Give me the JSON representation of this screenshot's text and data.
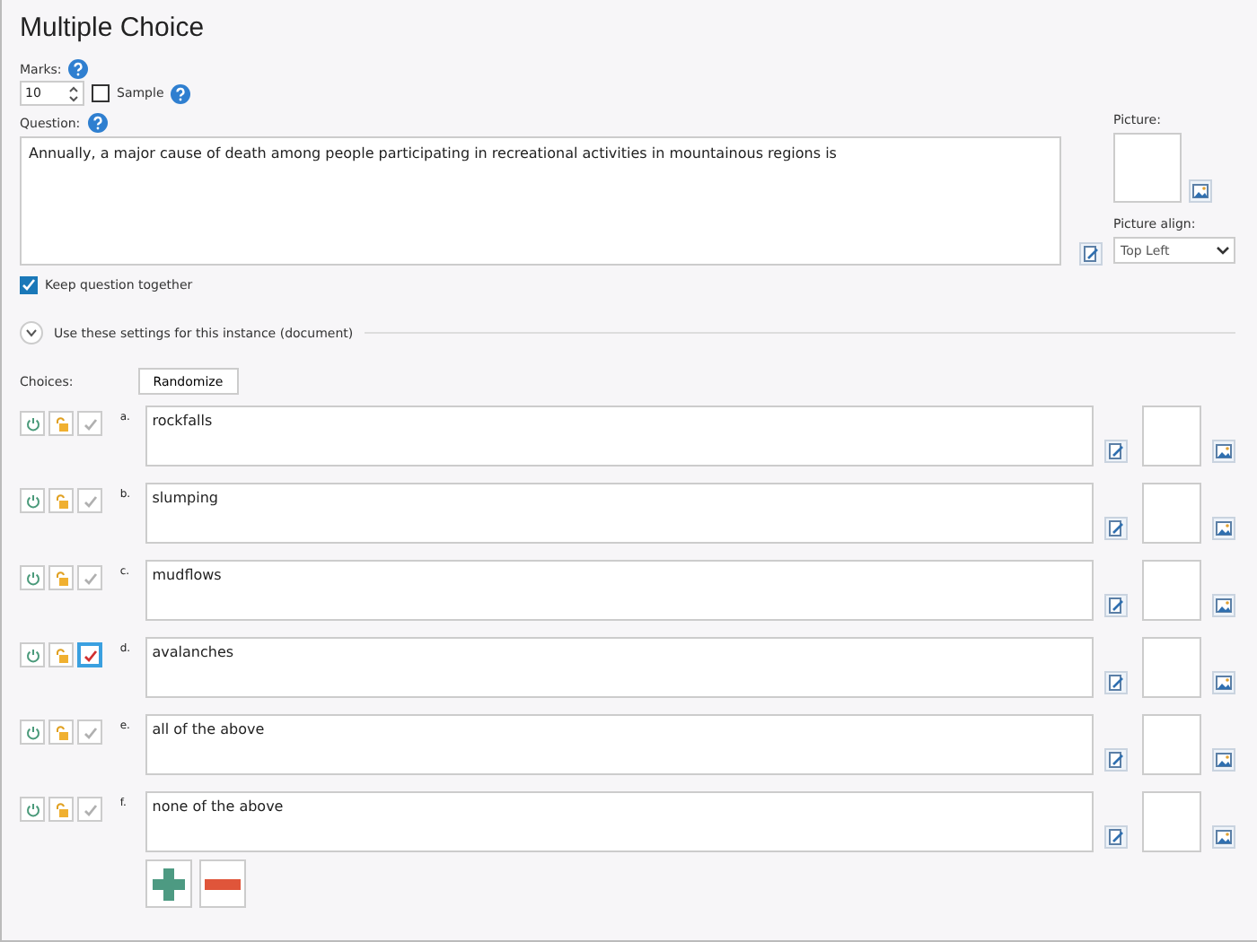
{
  "title": "Multiple Choice",
  "marks": {
    "label": "Marks:",
    "value": "10"
  },
  "sample": {
    "label": "Sample",
    "checked": false
  },
  "question": {
    "label": "Question:",
    "value": "Annually, a major cause of death among people participating in recreational activities in mountainous regions is"
  },
  "picture": {
    "label": "Picture:"
  },
  "picture_align": {
    "label": "Picture align:",
    "value": "Top Left"
  },
  "keep_together": {
    "label": "Keep question together",
    "checked": true
  },
  "instance_settings": {
    "label": "Use these settings for this instance (document)",
    "expanded": false
  },
  "choices_label": "Choices:",
  "randomize_button": "Randomize",
  "choices": [
    {
      "letter": "a.",
      "text": "rockfalls",
      "correct": false
    },
    {
      "letter": "b.",
      "text": "slumping",
      "correct": false
    },
    {
      "letter": "c.",
      "text": "mudflows",
      "correct": false
    },
    {
      "letter": "d.",
      "text": "avalanches",
      "correct": true
    },
    {
      "letter": "e.",
      "text": "all of the above",
      "correct": false
    },
    {
      "letter": "f.",
      "text": "none of the above",
      "correct": false
    }
  ]
}
